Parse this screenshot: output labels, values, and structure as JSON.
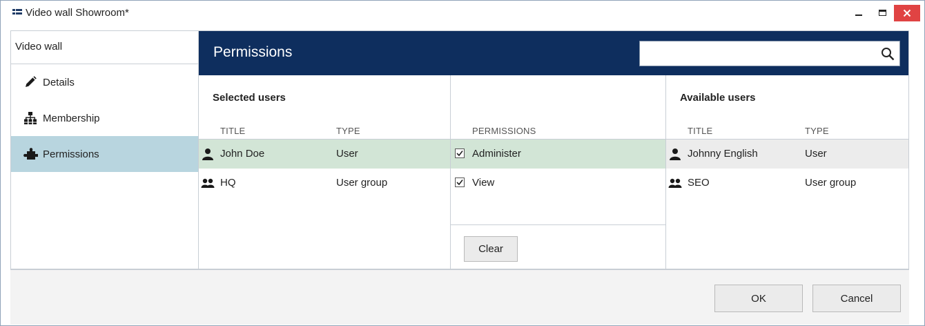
{
  "window": {
    "title": "Video wall Showroom*",
    "close_color": "#e04343"
  },
  "sidebar": {
    "header": "Video wall",
    "items": [
      {
        "label": "Details",
        "icon": "pencil-icon",
        "active": false
      },
      {
        "label": "Membership",
        "icon": "org-tree-icon",
        "active": false
      },
      {
        "label": "Permissions",
        "icon": "puzzle-icon",
        "active": true
      }
    ]
  },
  "main": {
    "title": "Permissions",
    "header_color": "#0e2e5e",
    "search": {
      "value": "",
      "placeholder": ""
    },
    "selected_users": {
      "title": "Selected users",
      "columns": [
        "TITLE",
        "TYPE"
      ],
      "rows": [
        {
          "icon": "user-icon",
          "title": "John Doe",
          "type": "User"
        },
        {
          "icon": "user-group-icon",
          "title": "HQ",
          "type": "User group"
        }
      ]
    },
    "permissions": {
      "column": "PERMISSIONS",
      "items": [
        {
          "label": "Administer",
          "checked": true
        },
        {
          "label": "View",
          "checked": true
        }
      ],
      "clear_label": "Clear"
    },
    "available_users": {
      "title": "Available users",
      "columns": [
        "TITLE",
        "TYPE"
      ],
      "rows": [
        {
          "icon": "user-icon",
          "title": "Johnny English",
          "type": "User"
        },
        {
          "icon": "user-group-icon",
          "title": "SEO",
          "type": "User group"
        }
      ]
    }
  },
  "footer": {
    "ok_label": "OK",
    "cancel_label": "Cancel"
  },
  "colors": {
    "selected_row": "#d2e5d6",
    "active_nav": "#b8d5df"
  }
}
